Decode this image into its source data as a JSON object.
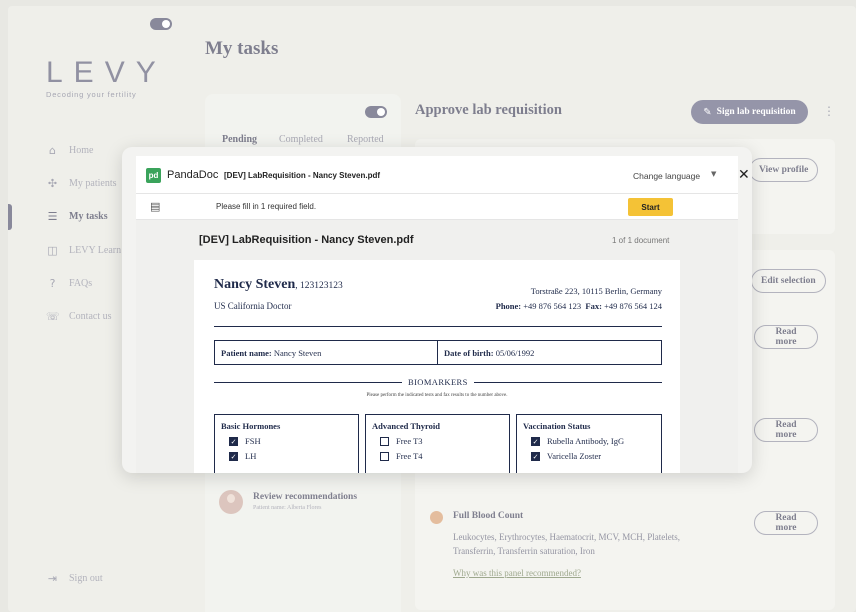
{
  "sidebar": {
    "logo": "LEVY",
    "tagline": "Decoding your fertility",
    "items": [
      {
        "label": "Home",
        "icon": "home-icon",
        "glyph": "⌂"
      },
      {
        "label": "My patients",
        "icon": "patients-icon",
        "glyph": "✣"
      },
      {
        "label": "My tasks",
        "icon": "tasks-icon",
        "glyph": "☰"
      },
      {
        "label": "LEVY Learn",
        "icon": "book-icon",
        "glyph": "◫"
      },
      {
        "label": "FAQs",
        "icon": "question-icon",
        "glyph": "?"
      },
      {
        "label": "Contact us",
        "icon": "contact-icon",
        "glyph": "☏"
      }
    ],
    "sign_out": "Sign out"
  },
  "main": {
    "title": "My tasks",
    "tabs": [
      "Pending",
      "Completed",
      "Reported"
    ],
    "review": {
      "title": "Review recommendations",
      "sub": "Patient name: Alberta Flores"
    }
  },
  "detail": {
    "title": "Approve lab requisition",
    "sign_button": "Sign lab requisition",
    "view_profile": "View profile",
    "edit_selection": "Edit selection",
    "read_more": "Read more",
    "fbc_title": "Full Blood Count",
    "fbc_text": "Leukocytes, Erythrocytes, Haematocrit, MCV, MCH, Platelets, Transferrin, Transferrin saturation, Iron",
    "fbc_link": "Why was this panel recommended?"
  },
  "modal": {
    "brand": "PandaDoc",
    "brand_mark": "pd",
    "file_title": "[DEV] LabRequisition - Nancy Steven.pdf",
    "change_language": "Change language",
    "message": "Please fill in 1 required field.",
    "start": "Start",
    "doc_name": "[DEV] LabRequisition - Nancy Steven.pdf",
    "doc_count": "1 of 1 document",
    "paper": {
      "name": "Nancy Steven",
      "id": ", 123123123",
      "role": "US California Doctor",
      "address": "Torstraße 223, 10115 Berlin, Germany",
      "phone_label": "Phone:",
      "phone": "+49 876 564 123",
      "fax_label": "Fax:",
      "fax": "+49 876 564 124",
      "patient_label": "Patient name:",
      "patient": "Nancy Steven",
      "dob_label": "Date of birth:",
      "dob": "05/06/1992",
      "biomarkers": "BIOMARKERS",
      "note": "Please perform the indicated tests and fax results to the number above.",
      "sections": [
        {
          "title": "Basic Hormones",
          "items": [
            {
              "label": "FSH",
              "checked": true
            },
            {
              "label": "LH",
              "checked": true
            }
          ]
        },
        {
          "title": "Advanced Thyroid",
          "items": [
            {
              "label": "Free T3",
              "checked": false
            },
            {
              "label": "Free T4",
              "checked": false
            }
          ]
        },
        {
          "title": "Vaccination Status",
          "items": [
            {
              "label": "Rubella Antibody, IgG",
              "checked": true
            },
            {
              "label": "Varicella Zoster",
              "checked": true
            }
          ]
        }
      ]
    }
  }
}
